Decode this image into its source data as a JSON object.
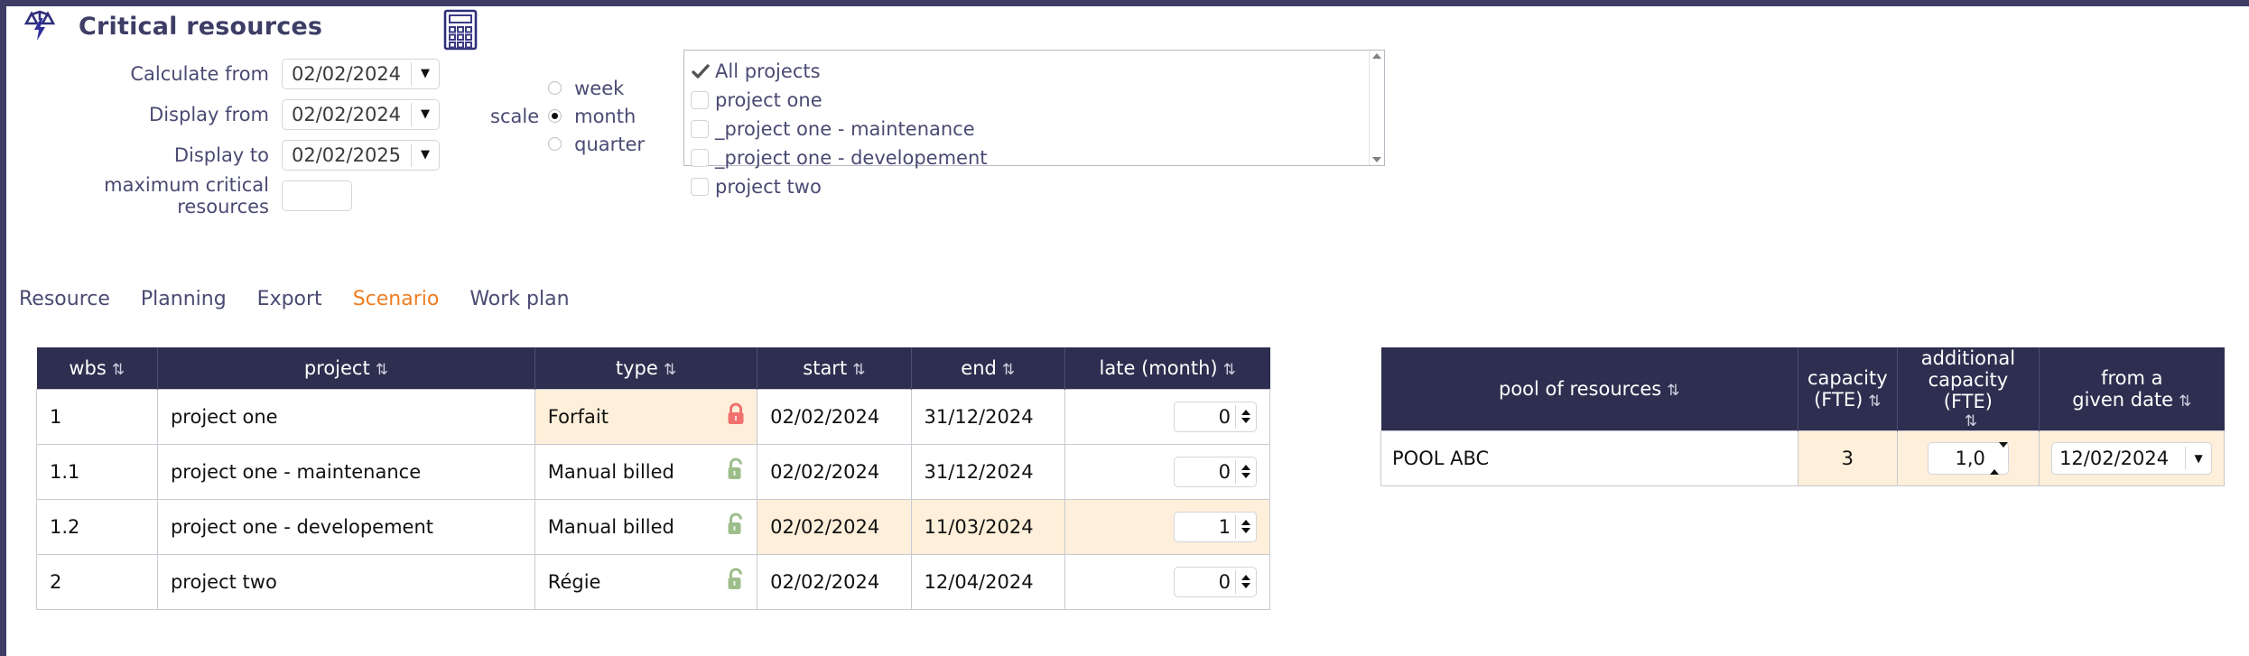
{
  "header": {
    "title": "Critical resources",
    "scale_icon": "balance-lightning-icon",
    "calculator_icon": "calculator-icon"
  },
  "form": {
    "fields": [
      {
        "label": "Calculate from",
        "value": "02/02/2024",
        "type": "date"
      },
      {
        "label": "Display from",
        "value": "02/02/2024",
        "type": "date"
      },
      {
        "label": "Display to",
        "value": "02/02/2025",
        "type": "date"
      }
    ],
    "max_critical": {
      "label": "maximum critical resources",
      "value": ""
    }
  },
  "scale": {
    "label": "scale",
    "options": [
      {
        "label": "week",
        "selected": false
      },
      {
        "label": "month",
        "selected": true
      },
      {
        "label": "quarter",
        "selected": false
      }
    ]
  },
  "projects": {
    "items": [
      {
        "label": "All projects",
        "checked": true
      },
      {
        "label": "project one",
        "checked": false
      },
      {
        "label": "_project one - maintenance",
        "checked": false
      },
      {
        "label": "_project one - developement",
        "checked": false
      },
      {
        "label": "project two",
        "checked": false
      }
    ]
  },
  "tabs": [
    {
      "label": "Resource",
      "active": false
    },
    {
      "label": "Planning",
      "active": false
    },
    {
      "label": "Export",
      "active": false
    },
    {
      "label": "Scenario",
      "active": true
    },
    {
      "label": "Work plan",
      "active": false
    }
  ],
  "main_table": {
    "columns": [
      "wbs",
      "project",
      "type",
      "start",
      "end",
      "late (month)"
    ],
    "sort_icon": "⇅",
    "rows": [
      {
        "wbs": "1",
        "project": "project one",
        "type": "Forfait",
        "lock": "locked-icon",
        "start": "02/02/2024",
        "end": "31/12/2024",
        "late": "0",
        "type_highlight": true,
        "dates_highlight": false
      },
      {
        "wbs": "1.1",
        "project": "project one - maintenance",
        "type": "Manual billed",
        "lock": "unlocked-icon",
        "start": "02/02/2024",
        "end": "31/12/2024",
        "late": "0",
        "type_highlight": false,
        "dates_highlight": false
      },
      {
        "wbs": "1.2",
        "project": "project one - developement",
        "type": "Manual billed",
        "lock": "unlocked-icon",
        "start": "02/02/2024",
        "end": "11/03/2024",
        "late": "1",
        "type_highlight": false,
        "dates_highlight": true
      },
      {
        "wbs": "2",
        "project": "project two",
        "type": "Régie",
        "lock": "unlocked-icon",
        "start": "02/02/2024",
        "end": "12/04/2024",
        "late": "0",
        "type_highlight": false,
        "dates_highlight": false
      }
    ]
  },
  "pool_table": {
    "columns": {
      "name": "pool of resources",
      "capacity": "capacity (FTE)",
      "capacity_l1": "capacity",
      "capacity_l2": "(FTE)",
      "additional_l1": "additional",
      "additional_l2": "capacity (FTE)",
      "from_l1": "from a",
      "from_l2": "given date"
    },
    "sort_icon": "⇅",
    "rows": [
      {
        "name": "POOL ABC",
        "capacity": "3",
        "additional": "1,0",
        "from_date": "12/02/2024"
      }
    ]
  },
  "colors": {
    "header_dark": "#2e2e50",
    "accent_orange": "#ef7d22",
    "row_tint": "#fdefd9",
    "label_text": "#4a4a73",
    "lock_red": "#f1716e",
    "lock_green": "#9dbd8b"
  }
}
